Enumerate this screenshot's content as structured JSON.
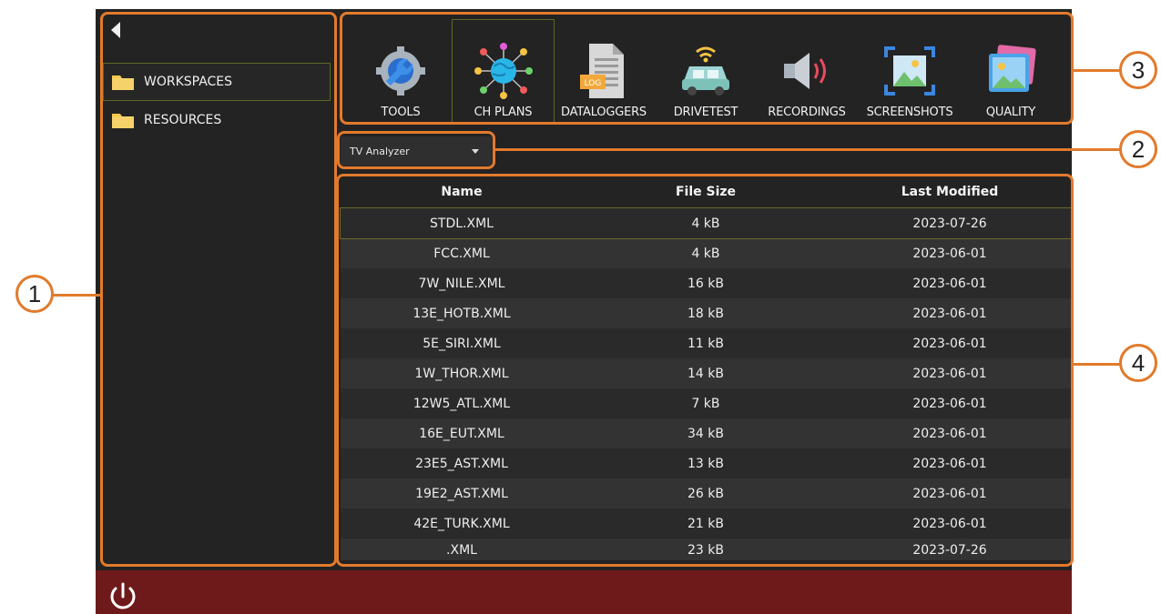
{
  "nav": {
    "items": [
      {
        "label": "WORKSPACES",
        "icon": "folder-icon",
        "selected": true
      },
      {
        "label": "RESOURCES",
        "icon": "folder-icon",
        "selected": false
      }
    ]
  },
  "toolbar": {
    "tools": [
      {
        "label": "TOOLS",
        "icon": "gear-wrench-icon",
        "selected": false
      },
      {
        "label": "CH PLANS",
        "icon": "globe-network-icon",
        "selected": true
      },
      {
        "label": "DATALOGGERS",
        "icon": "log-document-icon",
        "selected": false
      },
      {
        "label": "DRIVETEST",
        "icon": "car-wifi-icon",
        "selected": false
      },
      {
        "label": "RECORDINGS",
        "icon": "speaker-icon",
        "selected": false
      },
      {
        "label": "SCREENSHOTS",
        "icon": "screenshot-icon",
        "selected": false
      },
      {
        "label": "QUALITY",
        "icon": "image-stack-icon",
        "selected": false
      }
    ],
    "log_badge": "LOG"
  },
  "dropdown": {
    "value": "TV Analyzer"
  },
  "table": {
    "columns": [
      "Name",
      "File Size",
      "Last Modified"
    ],
    "rows": [
      {
        "name": "STDL.XML",
        "size": "4 kB",
        "modified": "2023-07-26",
        "selected": true
      },
      {
        "name": "FCC.XML",
        "size": "4 kB",
        "modified": "2023-06-01"
      },
      {
        "name": "7W_NILE.XML",
        "size": "16 kB",
        "modified": "2023-06-01"
      },
      {
        "name": "13E_HOTB.XML",
        "size": "18 kB",
        "modified": "2023-06-01"
      },
      {
        "name": "5E_SIRI.XML",
        "size": "11 kB",
        "modified": "2023-06-01"
      },
      {
        "name": "1W_THOR.XML",
        "size": "14 kB",
        "modified": "2023-06-01"
      },
      {
        "name": "12W5_ATL.XML",
        "size": "7 kB",
        "modified": "2023-06-01"
      },
      {
        "name": "16E_EUT.XML",
        "size": "34 kB",
        "modified": "2023-06-01"
      },
      {
        "name": "23E5_AST.XML",
        "size": "13 kB",
        "modified": "2023-06-01"
      },
      {
        "name": "19E2_AST.XML",
        "size": "26 kB",
        "modified": "2023-06-01"
      },
      {
        "name": "42E_TURK.XML",
        "size": "21 kB",
        "modified": "2023-06-01"
      },
      {
        "name": ".XML",
        "size": "23 kB",
        "modified": "2023-07-26"
      }
    ]
  },
  "callouts": [
    "1",
    "2",
    "3",
    "4"
  ],
  "colors": {
    "screen_bg": "#232323",
    "bottom_bar": "#6f1a1a",
    "callout": "#e27a2c",
    "selection_outline": "#5a6a25",
    "folder": "#f2c94c"
  }
}
